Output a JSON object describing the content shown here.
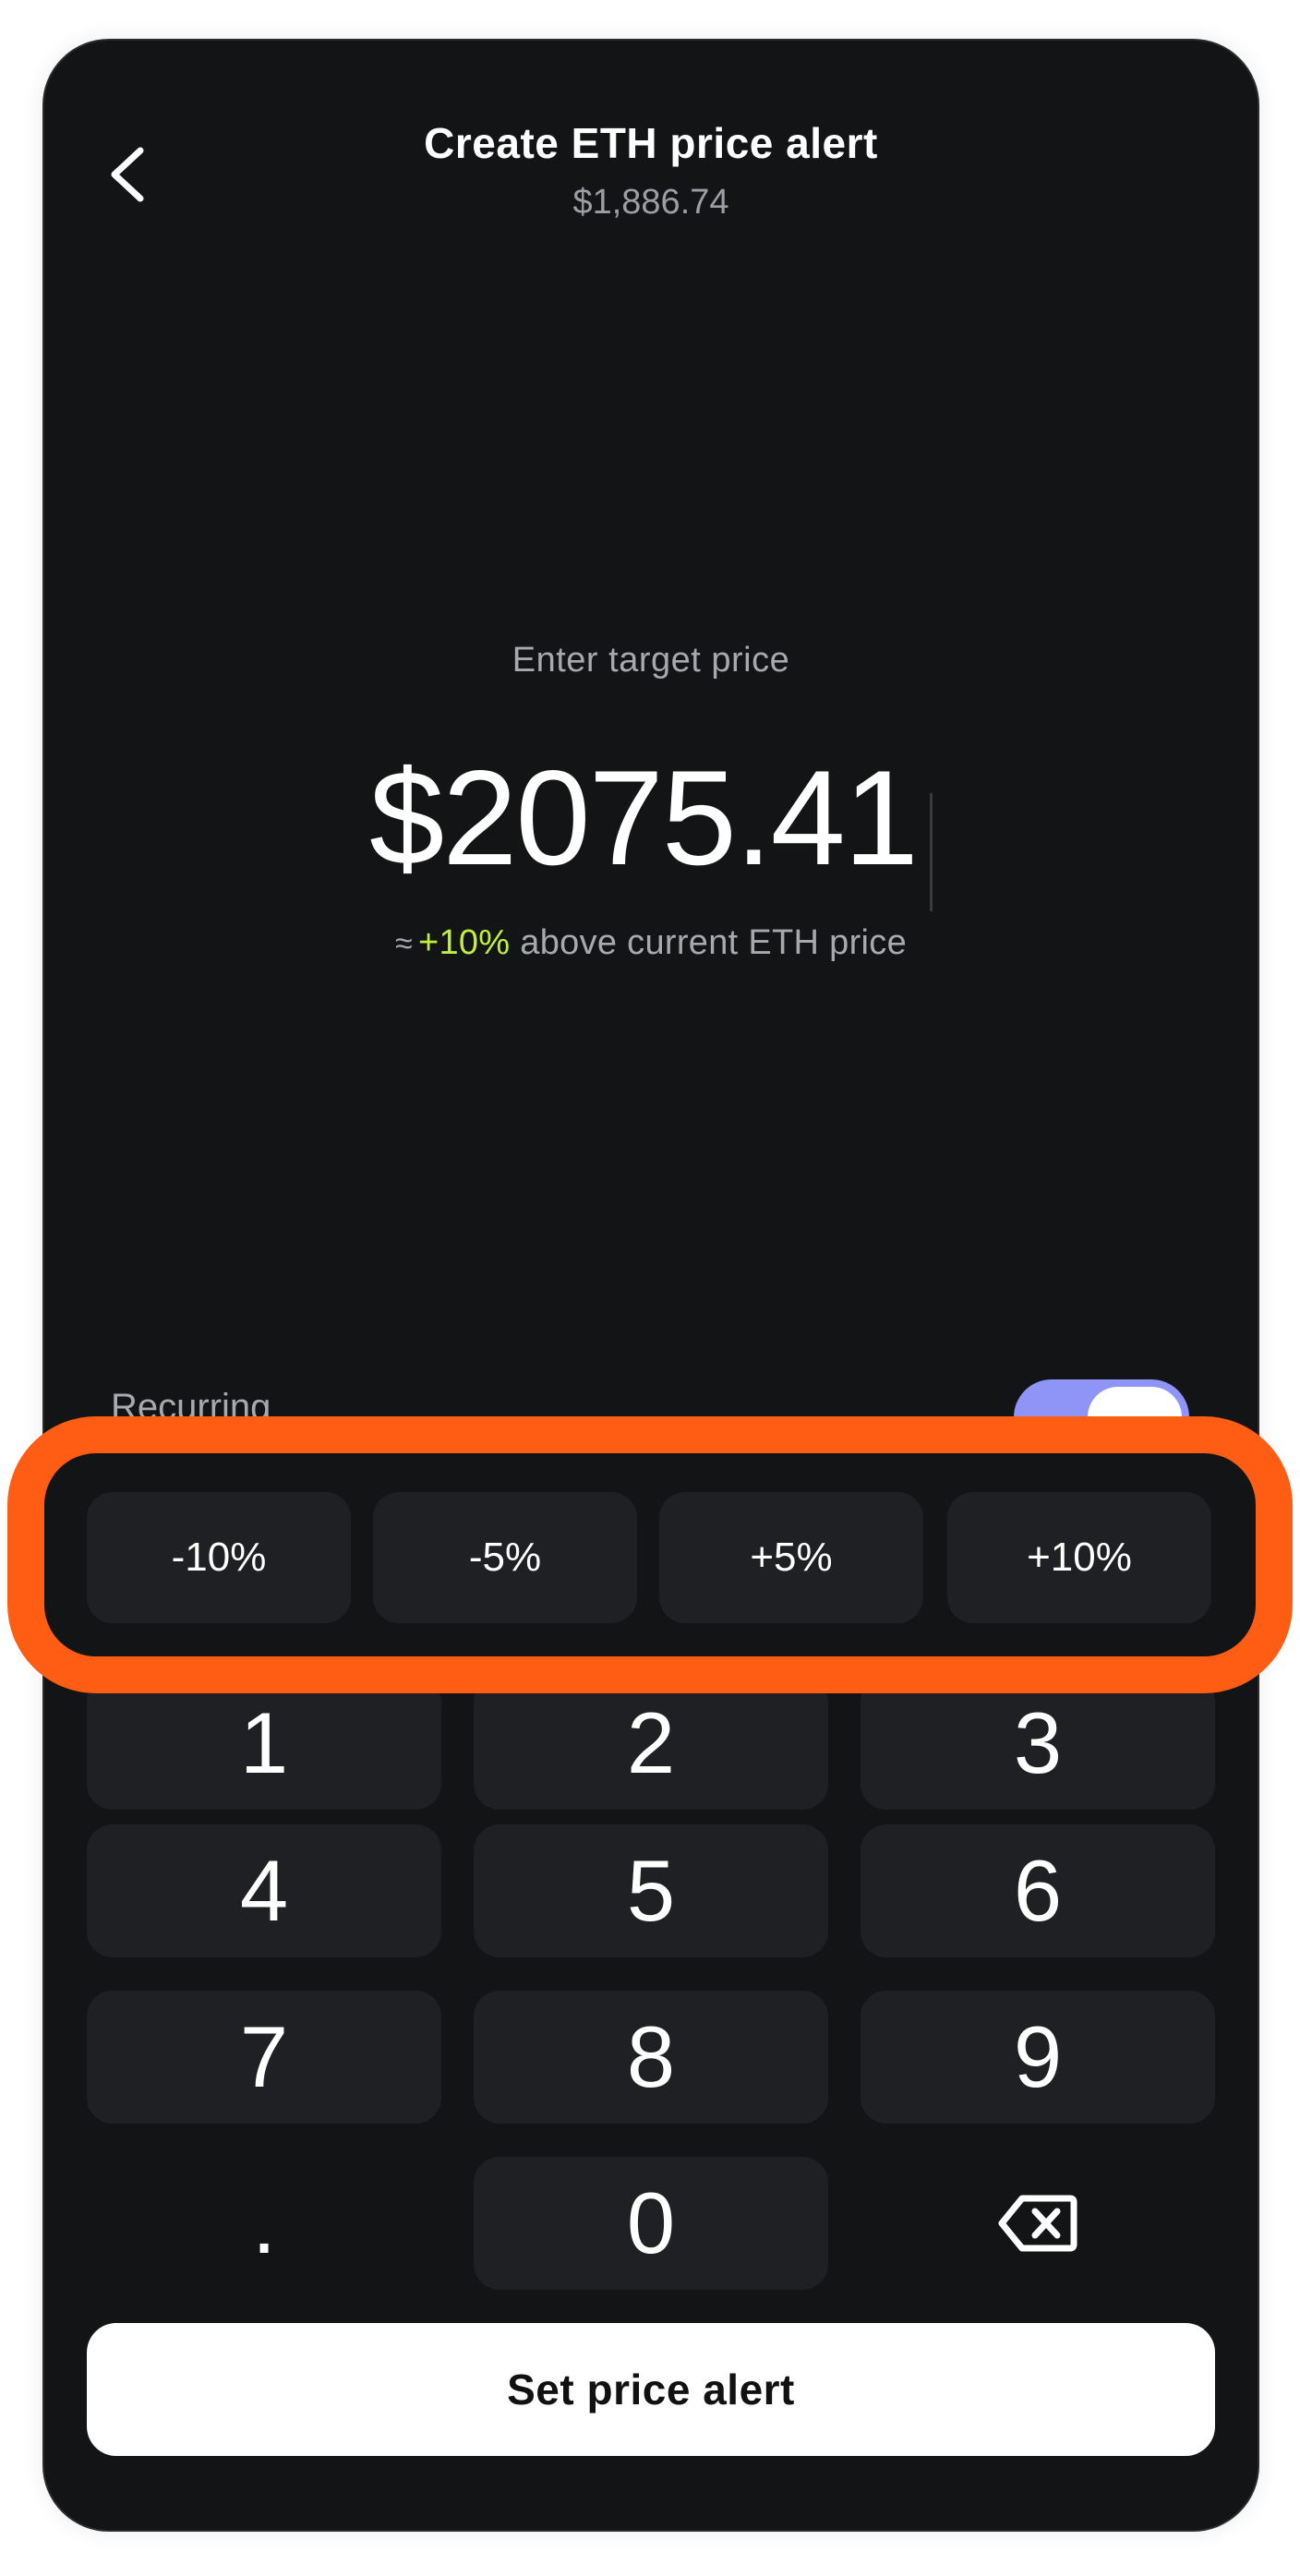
{
  "header": {
    "back_icon": "chevron-left-icon",
    "title": "Create ETH price alert",
    "current_price": "$1,886.74"
  },
  "entry": {
    "prompt": "Enter target price",
    "amount": "$2075.41",
    "approx_symbol": "≈",
    "change_percent": "+10%",
    "change_text": "above current ETH price"
  },
  "recurring": {
    "label": "Recurring",
    "enabled": true
  },
  "quick_adjust": [
    "-10%",
    "-5%",
    "+5%",
    "+10%"
  ],
  "keypad": {
    "keys": [
      "1",
      "2",
      "3",
      "4",
      "5",
      "6",
      "7",
      "8",
      "9",
      ".",
      "0"
    ],
    "backspace_icon": "backspace-icon"
  },
  "cta": {
    "label": "Set price alert"
  },
  "colors": {
    "background": "#131416",
    "key": "#1f2023",
    "accent_green": "#c2ee3e",
    "toggle": "#8e95f6",
    "highlight": "#ff5d14"
  }
}
